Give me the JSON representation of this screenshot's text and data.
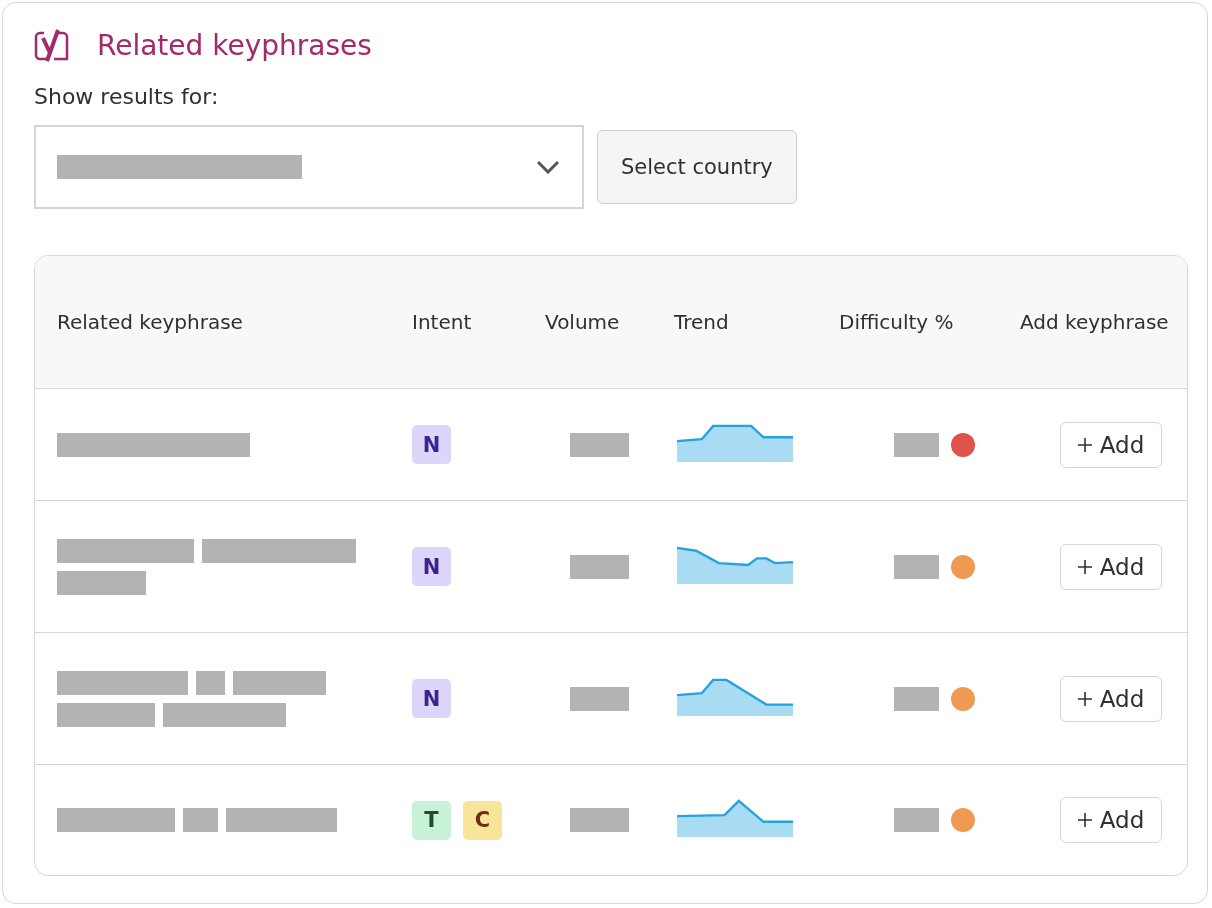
{
  "title": "Related keyphrases",
  "filter": {
    "label": "Show results for:",
    "button": "Select country"
  },
  "table": {
    "columns": [
      "Related keyphrase",
      "Intent",
      "Volume",
      "Trend",
      "Difficulty %",
      "Add keyphrase"
    ],
    "rows": [
      {
        "intents": [
          {
            "label": "N",
            "kind": "navigational"
          }
        ],
        "color": "#e0524a",
        "action": "Add"
      },
      {
        "intents": [
          {
            "label": "N",
            "kind": "navigational"
          }
        ],
        "color": "#ee9a52",
        "action": "Add"
      },
      {
        "intents": [
          {
            "label": "N",
            "kind": "navigational"
          }
        ],
        "color": "#ee9a52",
        "action": "Add"
      },
      {
        "intents": [
          {
            "label": "T",
            "kind": "transactional"
          },
          {
            "label": "C",
            "kind": "commercial"
          }
        ],
        "color": "#ee9a52",
        "action": "Add"
      }
    ]
  }
}
